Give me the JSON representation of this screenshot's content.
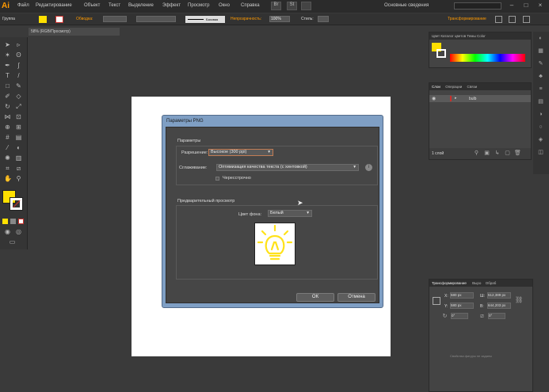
{
  "app": {
    "logo": "Ai",
    "workspace": "Основные сведения",
    "search_placeholder": ""
  },
  "menu": [
    "Файл",
    "Редактирование",
    "Объект",
    "Текст",
    "Выделение",
    "Эффект",
    "Просмотр",
    "Окно",
    "Справка"
  ],
  "control_bar": {
    "group_label": "Группа",
    "stroke_label": "Обводка:",
    "line_style": "Базовая",
    "opacity_label": "Непрозрачность:",
    "opacity_value": "100%",
    "styles_label": "Стиль:",
    "transform_label": "Трансформирование"
  },
  "document_tab": "58% (RGB/Просмотр)",
  "dialog": {
    "title": "Параметры PNG",
    "section_params": "Параметры",
    "resolution_label": "Разрешение:",
    "resolution_value": "Высокое (300 ppi)",
    "antialias_label": "Сглаживание:",
    "antialias_value": "Оптимизация качества текста (с хинтовкой)",
    "interlaced_label": "Чересстрочно",
    "preview_section": "Предварительный просмотр",
    "bg_label": "Цвет фона:",
    "bg_value": "Белый",
    "ok": "ОК",
    "cancel": "Отмена"
  },
  "color_panel": {
    "tabs": "Цвет  Каталог цветов  Темы Color"
  },
  "layers_panel": {
    "tabs": [
      "Слои",
      "Операции",
      "Связи"
    ],
    "layer_name": "bulb",
    "footer": "1 слой"
  },
  "transform_panel": {
    "tabs": [
      "Трансформирование",
      "Выро",
      "Обраб"
    ],
    "x_label": "X:",
    "x_value": "580 px",
    "y_label": "Y:",
    "y_value": "580 px",
    "w_label": "Ш:",
    "w_value": "512,389 px",
    "h_label": "В:",
    "h_value": "644,203 px",
    "angle1": "0°",
    "angle2": "0°",
    "note": "Свойства фигуры не заданы"
  },
  "colors": {
    "fill": "#ffe000",
    "stroke": "#c9302c",
    "accent": "#ff9a00"
  }
}
